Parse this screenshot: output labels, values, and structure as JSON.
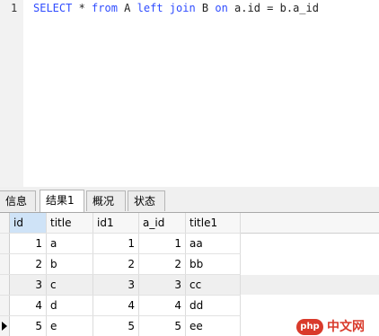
{
  "editor": {
    "line_number": "1",
    "tokens": [
      {
        "text": "SELECT",
        "cls": "kw"
      },
      {
        "text": " * ",
        "cls": "plain"
      },
      {
        "text": "from",
        "cls": "kw"
      },
      {
        "text": " A ",
        "cls": "plain"
      },
      {
        "text": "left",
        "cls": "kw"
      },
      {
        "text": " ",
        "cls": "plain"
      },
      {
        "text": "join",
        "cls": "kw"
      },
      {
        "text": " B ",
        "cls": "plain"
      },
      {
        "text": "on",
        "cls": "kw"
      },
      {
        "text": " a.id = b.a_id",
        "cls": "plain"
      }
    ]
  },
  "tabs": [
    {
      "label": "信息",
      "active": false
    },
    {
      "label": "结果1",
      "active": true
    },
    {
      "label": "概况",
      "active": false
    },
    {
      "label": "状态",
      "active": false
    }
  ],
  "grid": {
    "columns": [
      "id",
      "title",
      "id1",
      "a_id",
      "title1"
    ],
    "rows": [
      [
        "1",
        "a",
        "1",
        "1",
        "aa"
      ],
      [
        "2",
        "b",
        "2",
        "2",
        "bb"
      ],
      [
        "3",
        "c",
        "3",
        "3",
        "cc"
      ],
      [
        "4",
        "d",
        "4",
        "4",
        "dd"
      ],
      [
        "5",
        "e",
        "5",
        "5",
        "ee"
      ]
    ],
    "current_row": 4
  },
  "watermark": {
    "logo": "php",
    "text": "中文网"
  },
  "colors": {
    "keyword": "#2f4cff",
    "watermark": "#d93a2b",
    "selected_header": "#cfe3f7"
  }
}
